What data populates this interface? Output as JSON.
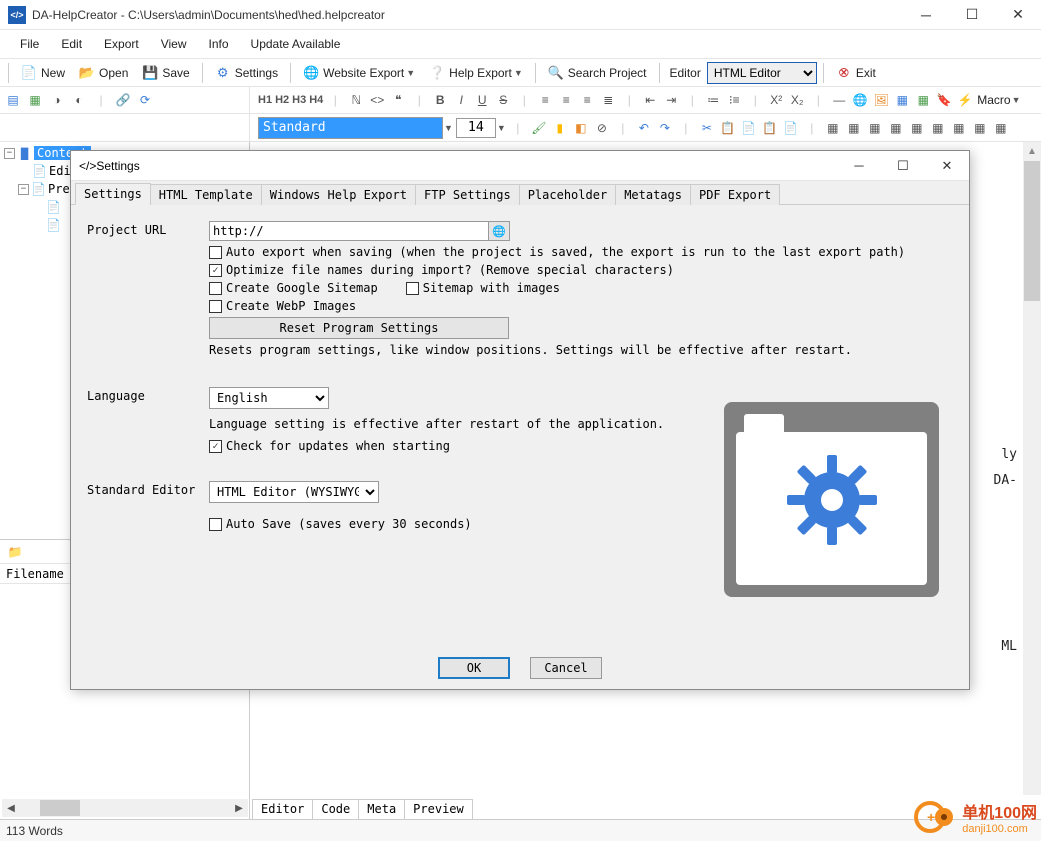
{
  "titlebar": {
    "app_icon_text": "</>",
    "title": "DA-HelpCreator - C:\\Users\\admin\\Documents\\hed\\hed.helpcreator"
  },
  "menubar": {
    "items": [
      "File",
      "Edit",
      "Export",
      "View",
      "Info",
      "Update Available"
    ]
  },
  "toolbar": {
    "new": "New",
    "open": "Open",
    "save": "Save",
    "settings": "Settings",
    "website_export": "Website Export",
    "help_export": "Help Export",
    "search_project": "Search Project",
    "editor_label": "Editor",
    "editor_value": "HTML Editor",
    "exit": "Exit"
  },
  "toolbar2": {
    "headers": [
      "H1",
      "H2",
      "H3",
      "H4"
    ],
    "macro": "Macro"
  },
  "toolbar3": {
    "style_select": "Standard",
    "font_size": "14"
  },
  "tree": {
    "root": "Content",
    "items": [
      "Edit",
      "Preview"
    ]
  },
  "sidebar_bottom": {
    "filename_header": "Filename"
  },
  "content_tabs": [
    "Editor",
    "Code",
    "Meta",
    "Preview"
  ],
  "statusbar": {
    "words": "113 Words"
  },
  "dialog": {
    "title": "Settings",
    "tabs": [
      "Settings",
      "HTML Template",
      "Windows Help Export",
      "FTP Settings",
      "Placeholder",
      "Metatags",
      "PDF Export"
    ],
    "project_url_label": "Project URL",
    "project_url_value": "http://",
    "auto_export_label": "Auto export when saving (when the project is saved, the export is run to the last export path)",
    "optimize_label": "Optimize file names during import? (Remove special characters)",
    "google_sitemap_label": "Create Google Sitemap",
    "sitemap_images_label": "Sitemap with images",
    "webp_label": "Create WebP Images",
    "reset_btn": "Reset Program Settings",
    "reset_note": "Resets program settings, like window positions. Settings will be effective after restart.",
    "language_label": "Language",
    "language_value": "English",
    "language_note": "Language setting is effective after restart of the application.",
    "check_updates_label": "Check for updates when starting",
    "std_editor_label": "Standard Editor",
    "std_editor_value": "HTML Editor (WYSIWYG)",
    "auto_save_label": "Auto Save (saves every 30 seconds)",
    "ok": "OK",
    "cancel": "Cancel",
    "checkboxes": {
      "auto_export": false,
      "optimize": true,
      "google_sitemap": false,
      "sitemap_images": false,
      "webp": false,
      "check_updates": true,
      "auto_save": false
    }
  },
  "bg_partial": {
    "line1": "ly",
    "line2": "DA-",
    "line3": "ML"
  },
  "watermark": {
    "text1": "单机100网",
    "text2": "danji100.com"
  }
}
